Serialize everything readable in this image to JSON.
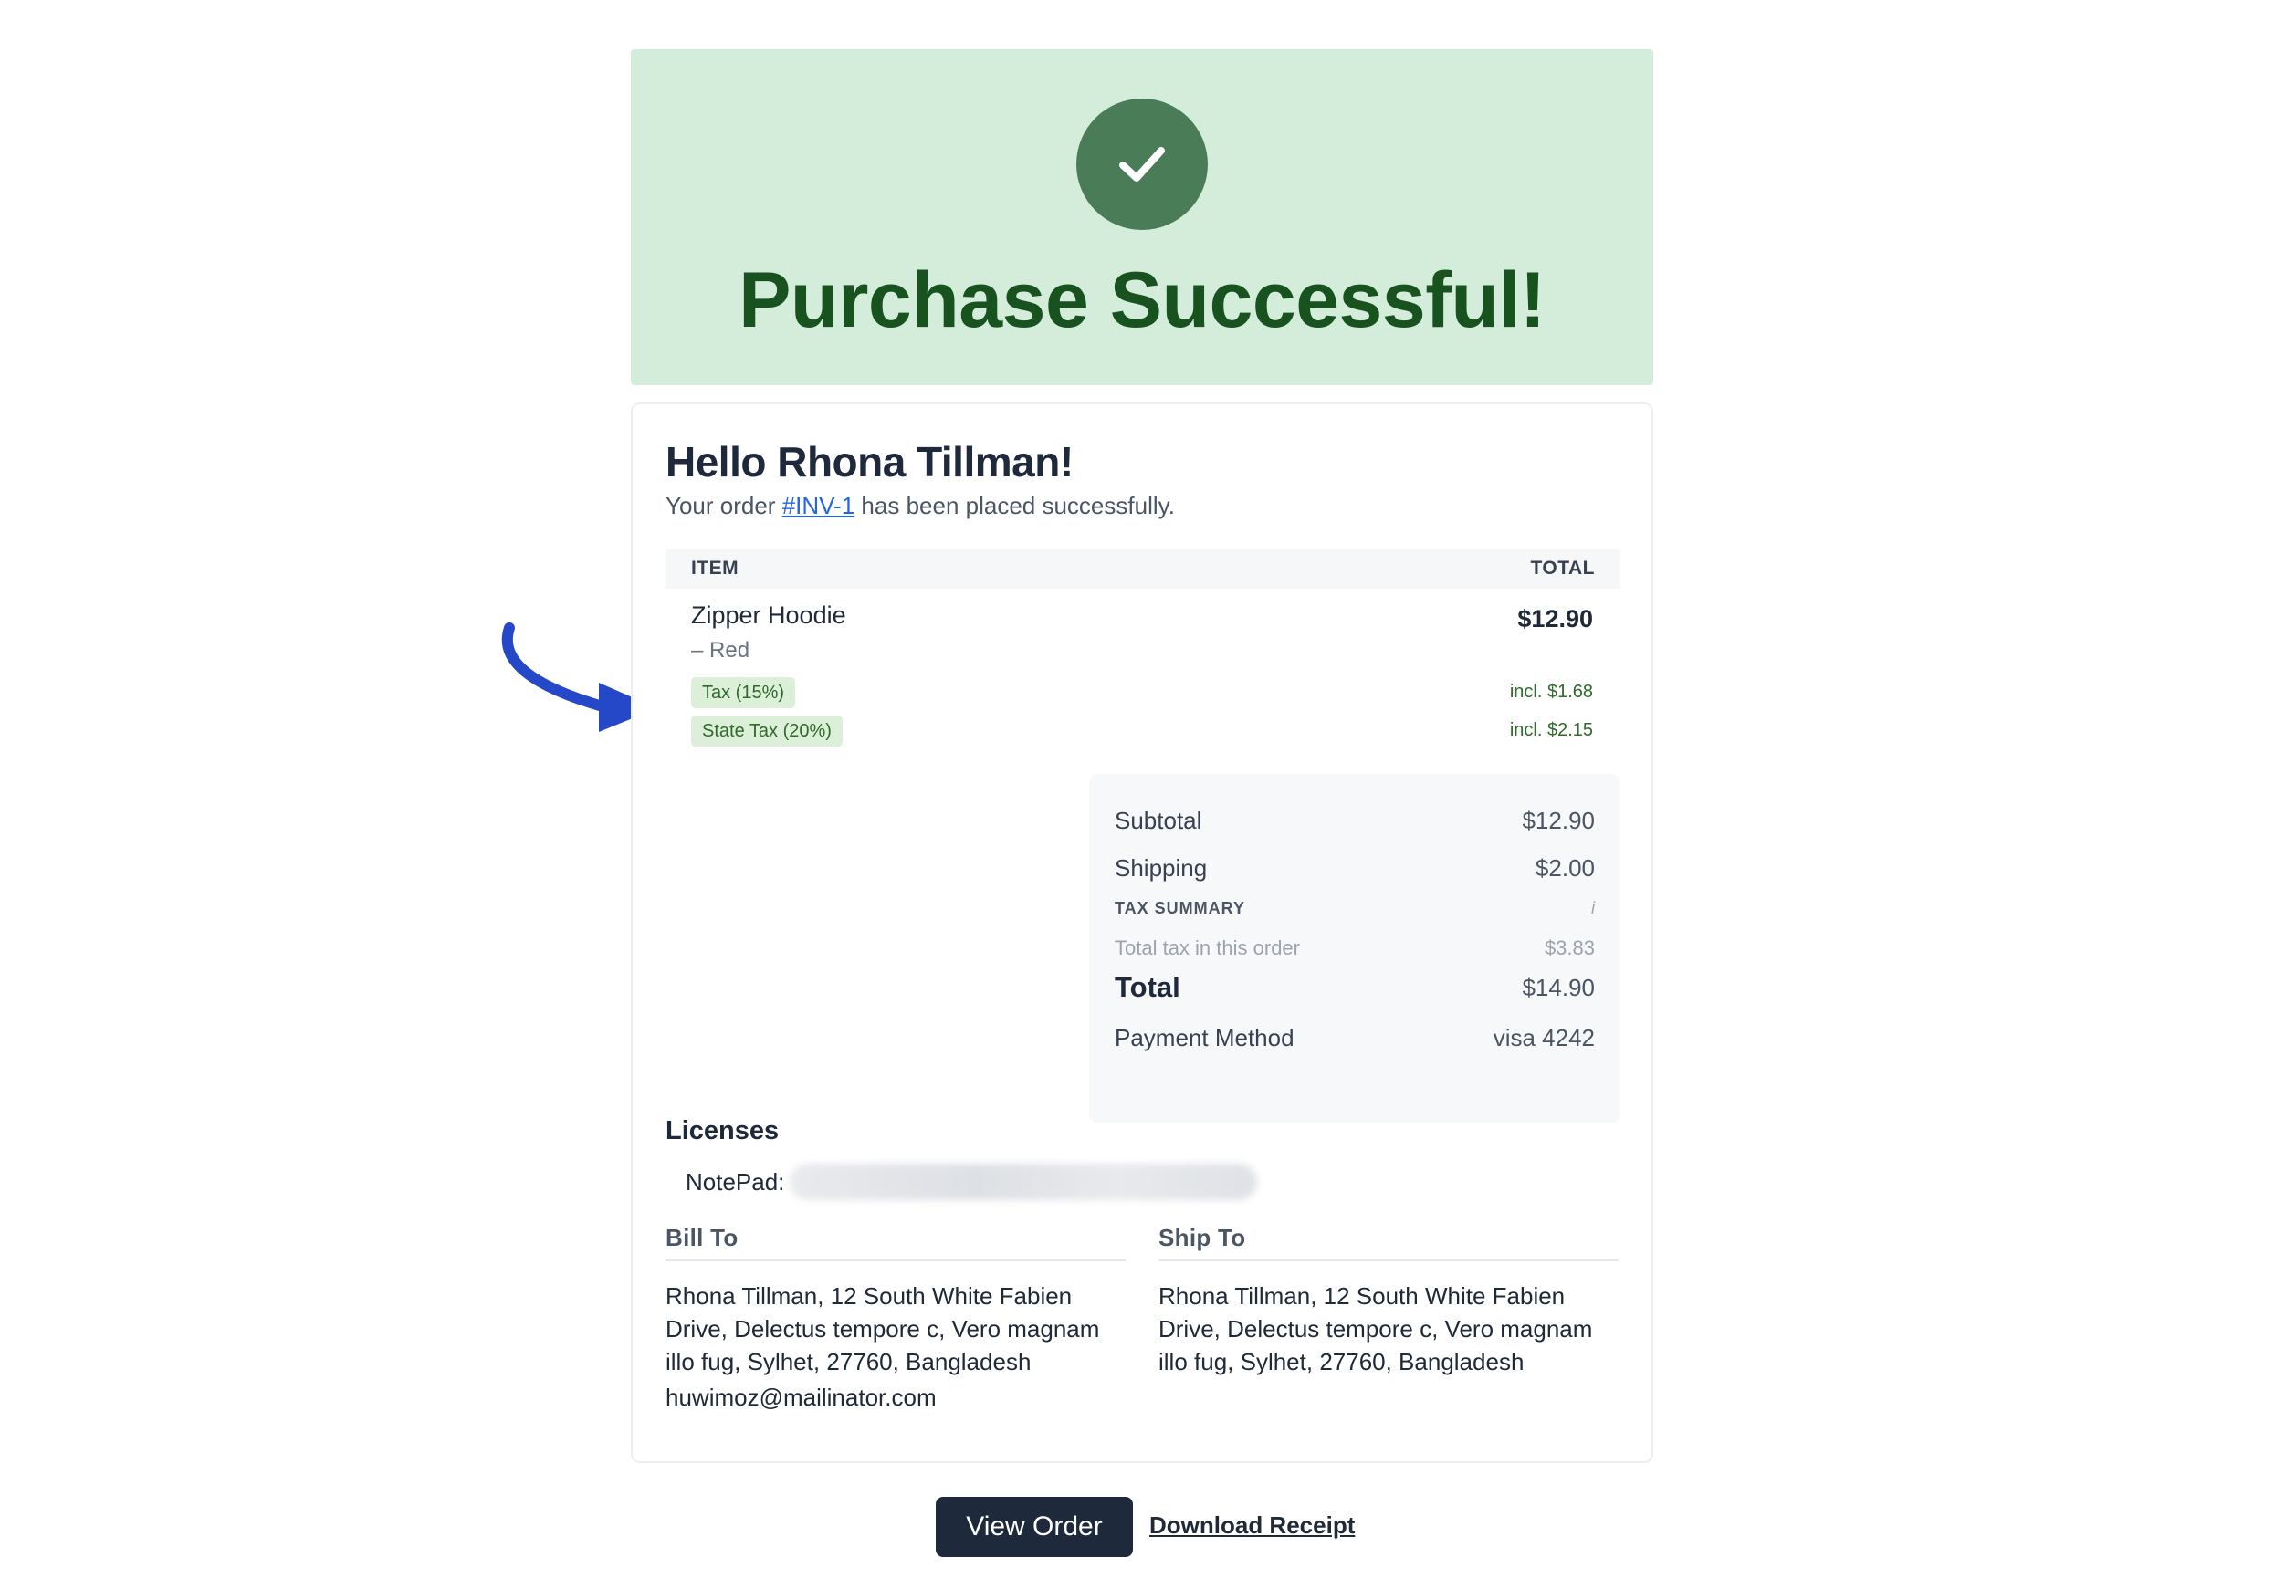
{
  "banner": {
    "title": "Purchase Successful!",
    "icon": "check-icon",
    "bg_color": "#d4ecda",
    "accent_color": "#4a7d57"
  },
  "greeting": "Hello Rhona Tillman!",
  "order": {
    "prefix": "Your order",
    "id": "#INV-1",
    "suffix": "has been placed successfully."
  },
  "items_table": {
    "columns": [
      "ITEM",
      "TOTAL"
    ],
    "items": [
      {
        "name": "Zipper Hoodie",
        "variant": "– Red",
        "total": "$12.90",
        "taxes": [
          {
            "label": "Tax (15%)",
            "value": "incl. $1.68"
          },
          {
            "label": "State Tax (20%)",
            "value": "incl. $2.15"
          }
        ]
      }
    ]
  },
  "summary": {
    "subtotal_label": "Subtotal",
    "subtotal_value": "$12.90",
    "shipping_label": "Shipping",
    "shipping_value": "$2.00",
    "tax_summary_label": "TAX SUMMARY",
    "tax_summary_icon": "i",
    "total_tax_label": "Total tax in this order",
    "total_tax_value": "$3.83",
    "total_label": "Total",
    "total_value": "$14.90",
    "payment_label": "Payment Method",
    "payment_value": "visa 4242"
  },
  "licenses": {
    "title": "Licenses",
    "items": [
      {
        "product": "NotePad:"
      }
    ]
  },
  "bill_to": {
    "title": "Bill To",
    "address": "Rhona Tillman, 12 South White Fabien Drive, Delectus tempore c, Vero magnam illo fug, Sylhet, 27760, Bangladesh",
    "email": "huwimoz@mailinator.com"
  },
  "ship_to": {
    "title": "Ship To",
    "address": "Rhona Tillman, 12 South White Fabien Drive, Delectus tempore c, Vero magnam illo fug, Sylhet, 27760, Bangladesh"
  },
  "actions": {
    "view_order": "View Order",
    "download_receipt": "Download Receipt"
  },
  "annotation": {
    "icon": "curved-arrow-icon",
    "color": "#2448c8"
  }
}
